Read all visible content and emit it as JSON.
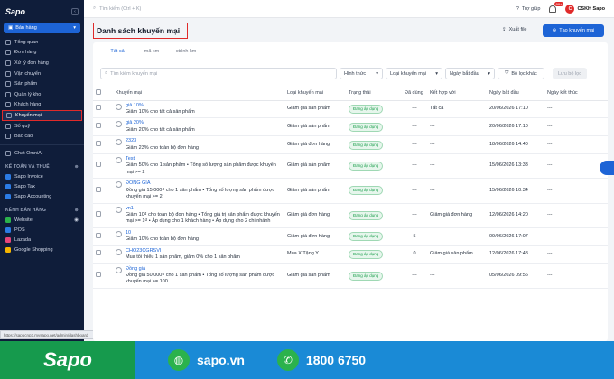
{
  "sidebar": {
    "logo": "Sapo",
    "store": "Bán hàng",
    "items": [
      {
        "label": "Tổng quan"
      },
      {
        "label": "Đơn hàng"
      },
      {
        "label": "Xử lý đơn hàng"
      },
      {
        "label": "Vận chuyển"
      },
      {
        "label": "Sản phẩm"
      },
      {
        "label": "Quản lý kho"
      },
      {
        "label": "Khách hàng"
      },
      {
        "label": "Khuyến mại"
      },
      {
        "label": "Sổ quỹ"
      },
      {
        "label": "Báo cáo"
      }
    ],
    "chat": "Chat OmniAI",
    "section1": "KẾ TOÁN VÀ THUẾ",
    "accounting": [
      "Sapo Invoice",
      "Sapo Tax",
      "Sapo Accounting"
    ],
    "section2": "KÊNH BÁN HÀNG",
    "channels": [
      "Website",
      "POS",
      "Lazada",
      "Google Shopping"
    ],
    "url_hint": "https://sapocnp3.mysapo.net/admin/dashboard"
  },
  "topbar": {
    "search_placeholder": "Tìm kiếm (Ctrl + K)",
    "help": "Trợ giúp",
    "badge": "99+",
    "user": "CSKH Sapo",
    "avatar": "C"
  },
  "header": {
    "title": "Danh sách khuyến mại",
    "export": "Xuất file",
    "create": "Tạo khuyến mại"
  },
  "tabs": [
    "Tất cả",
    "mã km",
    "ctrình km"
  ],
  "filters": {
    "search_placeholder": "Tìm kiếm khuyến mại",
    "f1": "Hình thức",
    "f2": "Loại khuyến mại",
    "f3": "Ngày bắt đầu",
    "f4": "Bộ lọc khác",
    "save": "Lưu bộ lọc"
  },
  "table": {
    "columns": [
      "Khuyến mại",
      "Loại khuyến mại",
      "Trạng thái",
      "Đã dùng",
      "Kết hợp với",
      "Ngày bắt đầu",
      "Ngày kết thúc"
    ],
    "rows": [
      {
        "name": "giả 10%",
        "desc": "Giảm 10% cho tất cả sản phẩm",
        "type": "Giảm giá sản phẩm",
        "status": "Đang áp dụng",
        "used": "---",
        "combo": "Tất cả",
        "start": "20/06/2026 17:10",
        "end": "---"
      },
      {
        "name": "giả 20%",
        "desc": "Giảm 20% cho tất cả sản phẩm",
        "type": "Giảm giá sản phẩm",
        "status": "Đang áp dụng",
        "used": "---",
        "combo": "---",
        "start": "20/06/2026 17:10",
        "end": "---"
      },
      {
        "name": "2323",
        "desc": "Giảm 23% cho toàn bộ đơn hàng",
        "type": "Giảm giá đơn hàng",
        "status": "Đang áp dụng",
        "used": "---",
        "combo": "---",
        "start": "18/06/2026 14:40",
        "end": "---"
      },
      {
        "name": "Test",
        "desc": "Giảm 50% cho 1 sản phẩm • Tổng số lượng sản phẩm được khuyến mại >= 2",
        "type": "Giảm giá sản phẩm",
        "status": "Đang áp dụng",
        "used": "---",
        "combo": "---",
        "start": "15/06/2026 13:33",
        "end": "---"
      },
      {
        "name": "ĐỒNG GIÁ",
        "desc": "Đồng giá 15,000₫ cho 1 sản phẩm • Tổng số lượng sản phẩm được khuyến mại >= 2",
        "type": "Giảm giá sản phẩm",
        "status": "Đang áp dụng",
        "used": "---",
        "combo": "---",
        "start": "15/06/2026 10:34",
        "end": "---"
      },
      {
        "name": "vn1",
        "desc": "Giảm 10₫ cho toàn bộ đơn hàng • Tổng giá trị sản phẩm được khuyến mại >= 1₫ • Áp dụng cho 1 khách hàng • Áp dụng cho 2 chi nhánh",
        "type": "Giảm giá đơn hàng",
        "status": "Đang áp dụng",
        "used": "---",
        "combo": "Giảm giá đơn hàng",
        "start": "12/06/2026 14:20",
        "end": "---"
      },
      {
        "name": "10",
        "desc": "Giảm 10% cho toàn bộ đơn hàng",
        "type": "Giảm giá đơn hàng",
        "status": "Đang áp dụng",
        "used": "5",
        "combo": "---",
        "start": "09/06/2026 17:07",
        "end": "---"
      },
      {
        "name": "CHO23CGRSVI",
        "desc": "Mua tối thiểu 1 sản phẩm, giảm 0% cho 1 sản phẩm",
        "type": "Mua X Tặng Y",
        "status": "Đang áp dụng",
        "used": "0",
        "combo": "Giảm giá sản phẩm",
        "start": "12/06/2026 17:48",
        "end": "---"
      },
      {
        "name": "Đồng giá",
        "desc": "Đồng giá 50,000₫ cho 1 sản phẩm • Tổng số lượng sản phẩm được khuyến mại >= 100",
        "type": "Giảm giá sản phẩm",
        "status": "Đang áp dụng",
        "used": "---",
        "combo": "---",
        "start": "05/06/2026 09:56",
        "end": "---"
      }
    ]
  },
  "banner": {
    "logo": "Sapo",
    "site": "sapo.vn",
    "phone": "1800 6750"
  },
  "colors": {
    "sidebar_bg": "#0f1d3a",
    "accent": "#1d64d6",
    "highlight": "#e02a2a",
    "status_green": "#1a9e4b",
    "banner_blue": "#1a8ad6",
    "banner_green": "#169a4d"
  }
}
